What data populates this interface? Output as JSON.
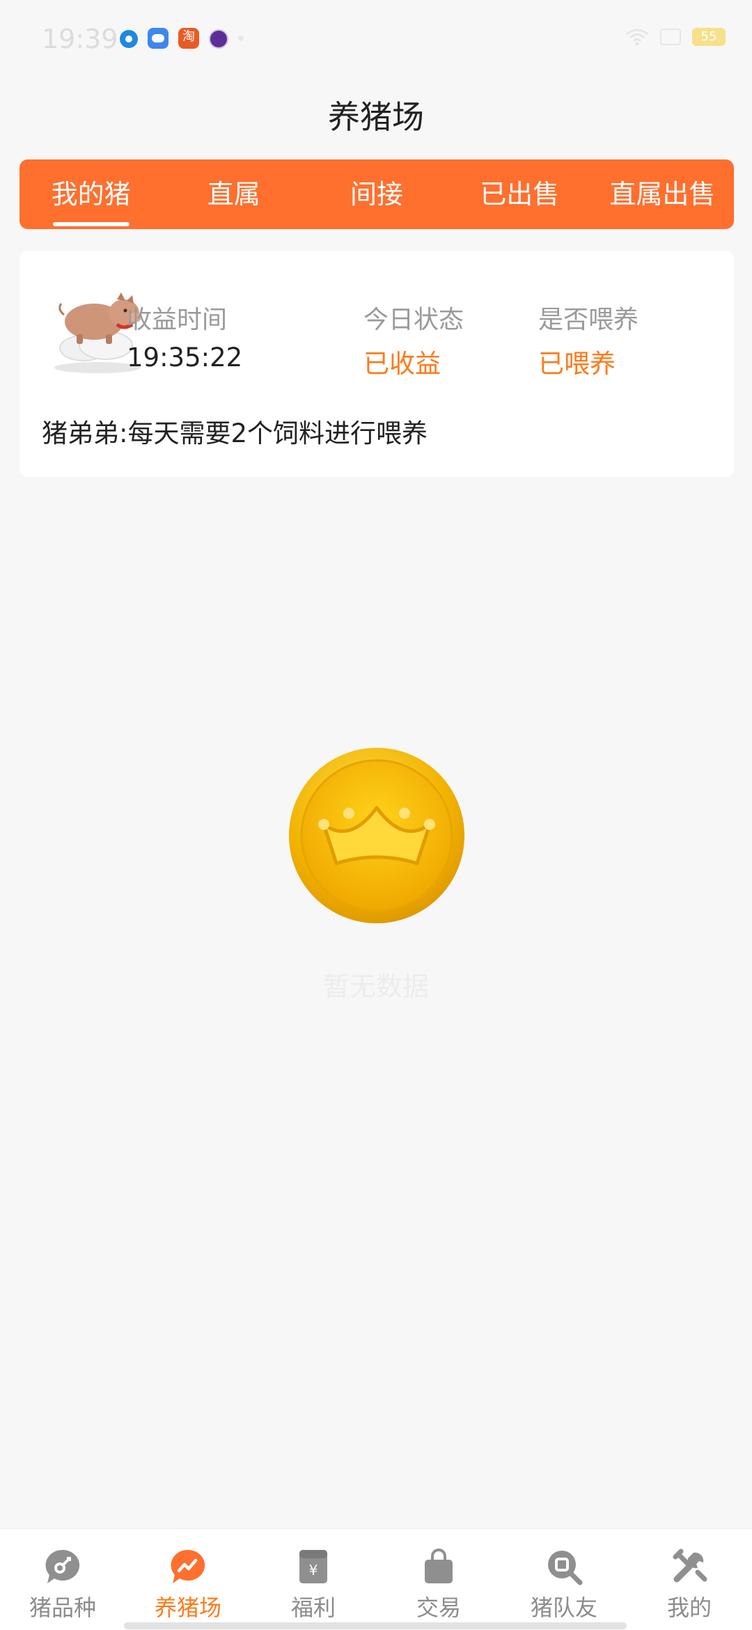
{
  "status_bar": {
    "time": "19:39",
    "battery": "55"
  },
  "page": {
    "title": "养猪场"
  },
  "tabs": [
    {
      "label": "我的猪",
      "active": true
    },
    {
      "label": "直属",
      "active": false
    },
    {
      "label": "间接",
      "active": false
    },
    {
      "label": "已出售",
      "active": false
    },
    {
      "label": "直属出售",
      "active": false
    }
  ],
  "pig_card": {
    "stats": [
      {
        "label": "收益时间",
        "value": "19:35:22"
      },
      {
        "label": "今日状态",
        "value": "已收益"
      },
      {
        "label": "是否喂养",
        "value": "已喂养"
      }
    ],
    "note": "猪弟弟:每天需要2个饲料进行喂养"
  },
  "empty_state": {
    "text": "暂无数据"
  },
  "bottom_nav": [
    {
      "label": "猪品种",
      "icon": "pig-breed-icon",
      "active": false
    },
    {
      "label": "养猪场",
      "icon": "pig-farm-icon",
      "active": true
    },
    {
      "label": "福利",
      "icon": "welfare-icon",
      "active": false
    },
    {
      "label": "交易",
      "icon": "trade-bag-icon",
      "active": false
    },
    {
      "label": "猪队友",
      "icon": "team-search-icon",
      "active": false
    },
    {
      "label": "我的",
      "icon": "tools-icon",
      "active": false
    }
  ],
  "colors": {
    "accent": "#ff6f2e",
    "status_orange": "#ff7a1a",
    "background": "#f7f7f7"
  }
}
